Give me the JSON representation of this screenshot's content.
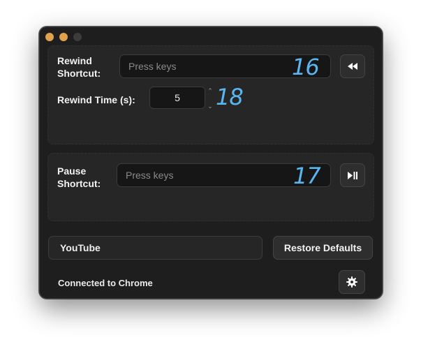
{
  "window": {
    "controls": [
      "close",
      "minimize",
      "maximize"
    ]
  },
  "rewind": {
    "label_line1": "Rewind",
    "label_line2": "Shortcut:",
    "shortcut_placeholder": "Press keys",
    "shortcut_annotation": "16",
    "button_icon": "rewind-icon",
    "time_label": "Rewind Time (s):",
    "time_value": "5",
    "time_annotation": "18"
  },
  "pause": {
    "label_line1": "Pause",
    "label_line2": "Shortcut:",
    "shortcut_placeholder": "Press keys",
    "shortcut_annotation": "17",
    "button_icon": "play-pause-icon"
  },
  "site_field": {
    "value": "YouTube"
  },
  "restore_button": {
    "label": "Restore Defaults"
  },
  "status": {
    "text": "Connected to Chrome"
  },
  "settings_button": {
    "icon": "gear-icon"
  },
  "colors": {
    "window_bg": "#1e1e1e",
    "panel_bg": "#262626",
    "annotation": "#5ab6f0",
    "traffic_light": "#e0a24a"
  }
}
